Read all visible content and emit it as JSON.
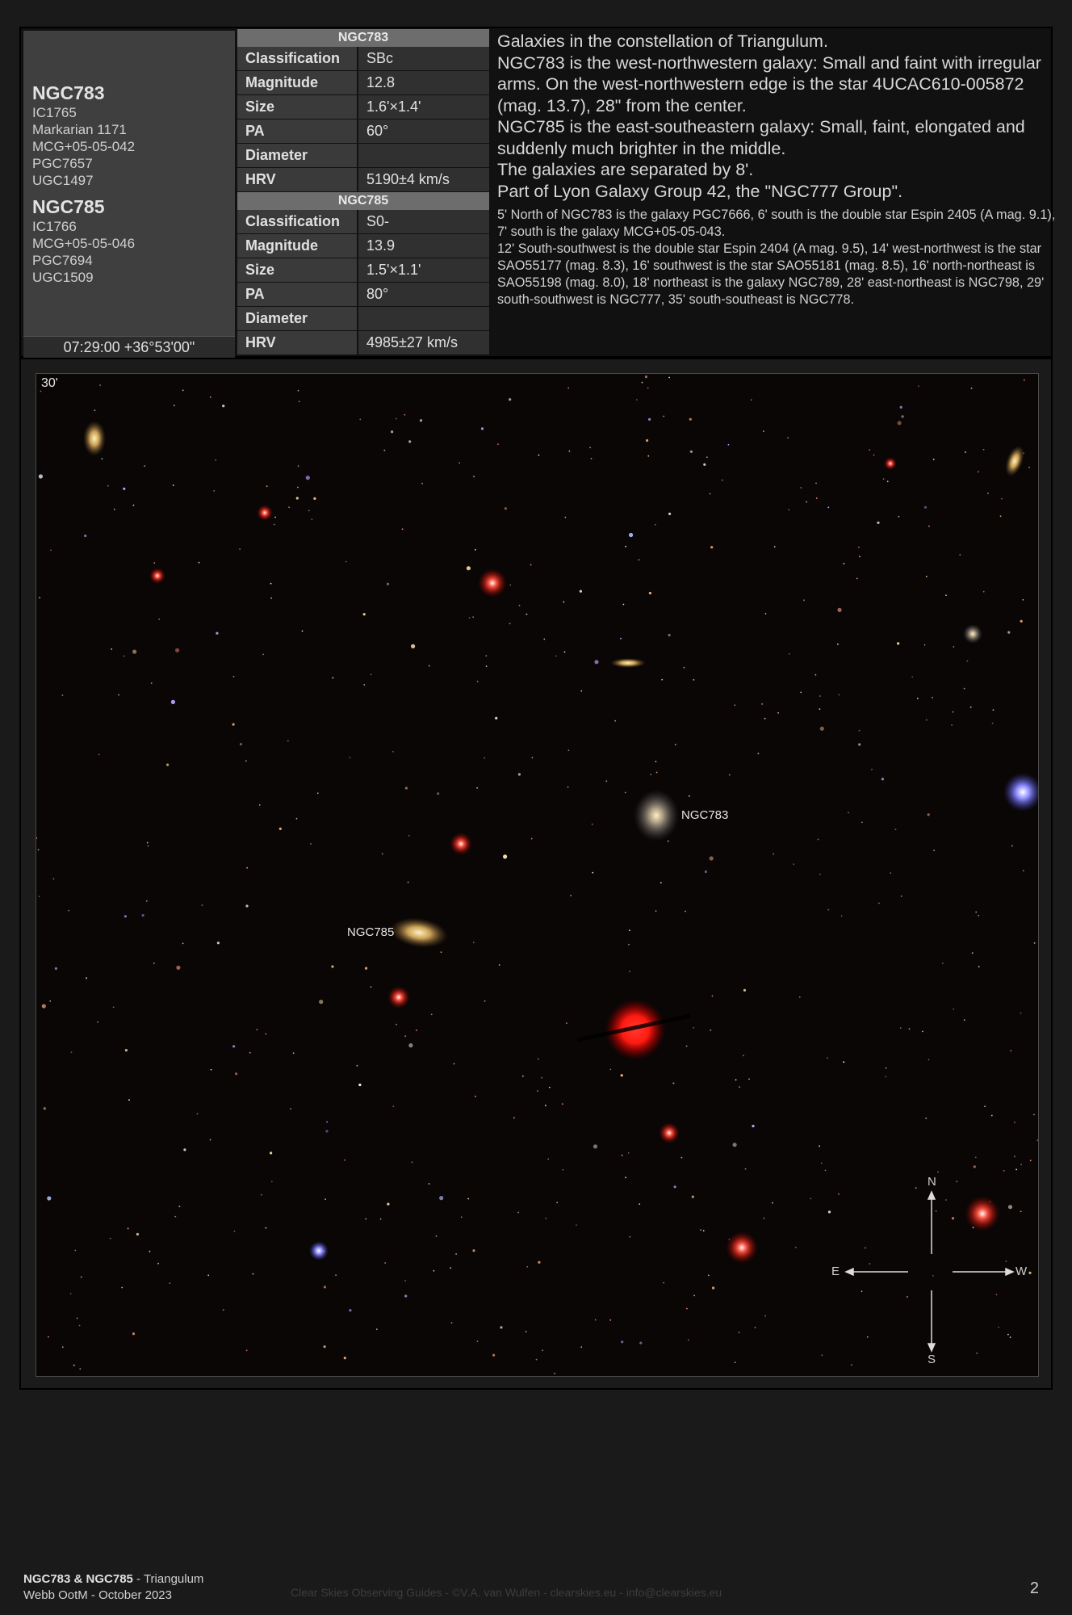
{
  "objects": [
    {
      "name": "NGC783",
      "aliases": [
        "IC1765",
        "Markarian 1171",
        "MCG+05-05-042",
        "PGC7657",
        "UGC1497"
      ]
    },
    {
      "name": "NGC785",
      "aliases": [
        "IC1766",
        "MCG+05-05-046",
        "PGC7694",
        "UGC1509"
      ]
    }
  ],
  "coordinates": "07:29:00 +36°53'00\"",
  "tables": [
    {
      "title": "NGC783",
      "rows": [
        {
          "key": "Classification",
          "value": "SBc"
        },
        {
          "key": "Magnitude",
          "value": "12.8"
        },
        {
          "key": "Size",
          "value": "1.6'×1.4'"
        },
        {
          "key": "PA",
          "value": "60°"
        },
        {
          "key": "Diameter",
          "value": ""
        },
        {
          "key": "HRV",
          "value": "5190±4 km/s"
        }
      ]
    },
    {
      "title": "NGC785",
      "rows": [
        {
          "key": "Classification",
          "value": "S0-"
        },
        {
          "key": "Magnitude",
          "value": "13.9"
        },
        {
          "key": "Size",
          "value": "1.5'×1.1'"
        },
        {
          "key": "PA",
          "value": "80°"
        },
        {
          "key": "Diameter",
          "value": ""
        },
        {
          "key": "HRV",
          "value": "4985±27 km/s"
        }
      ]
    }
  ],
  "description": {
    "main": [
      "Galaxies in the constellation of Triangulum.",
      "NGC783 is the west-northwestern galaxy: Small and faint with irregular arms. On the west-northwestern edge is the star 4UCAC610-005872 (mag. 13.7), 28\" from the center.",
      "NGC785 is the east-southeastern galaxy: Small, faint, elongated and suddenly much brighter in the middle.",
      "The galaxies are separated by 8'.",
      "Part of Lyon Galaxy Group 42, the \"NGC777 Group\"."
    ],
    "notes": [
      "5' North of NGC783 is the galaxy PGC7666, 6' south is the double star Espin 2405 (A mag. 9.1), 7' south is the galaxy MCG+05-05-043.",
      "12' South-southwest is the double star Espin 2404 (A mag. 9.5), 14' west-northwest is the star SAO55177 (mag. 8.3), 16' southwest is the star SAO55181 (mag. 8.5), 16' north-northeast is SAO55198 (mag. 8.0), 18' northeast is the galaxy NGC789, 28' east-northeast is NGC798, 29' south-southwest is NGC777, 35' south-southeast is NGC778."
    ]
  },
  "image": {
    "scale_label": "30'",
    "labels": {
      "ngc783": "NGC783",
      "ngc785": "NGC785"
    },
    "compass": {
      "n": "N",
      "s": "S",
      "e": "E",
      "w": "W"
    }
  },
  "footer": {
    "title": "NGC783 & NGC785",
    "constellation": " - Triangulum",
    "subtitle": "Webb OotM - October 2023",
    "credit": "Clear Skies Observing Guides - ©V.A. van Wulfen - clearskies.eu - info@clearskies.eu",
    "page": "2"
  }
}
